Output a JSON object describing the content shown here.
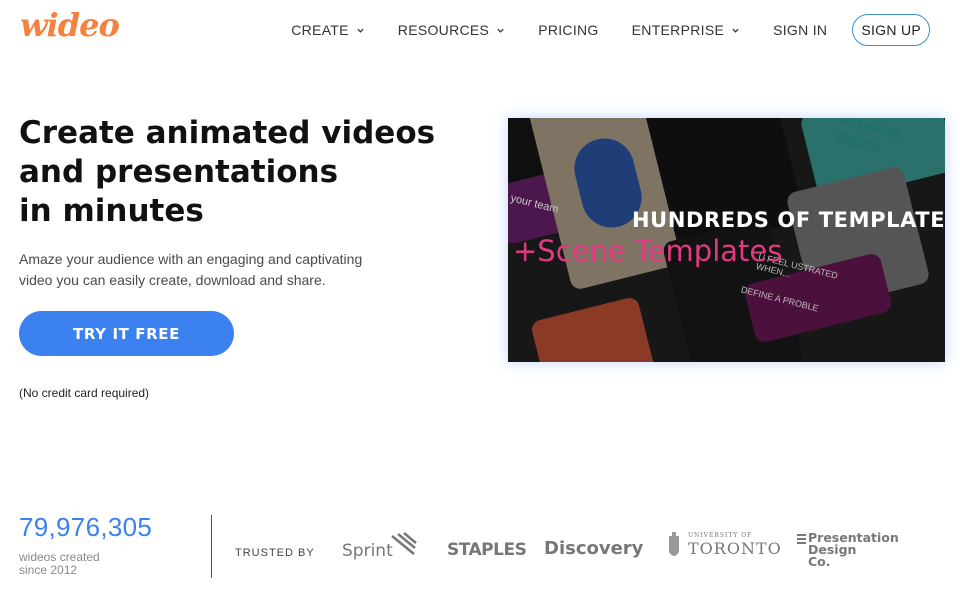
{
  "header": {
    "logo": "wideo",
    "nav": [
      {
        "label": "CREATE",
        "dropdown": true
      },
      {
        "label": "RESOURCES",
        "dropdown": true
      },
      {
        "label": "PRICING",
        "dropdown": false
      },
      {
        "label": "ENTERPRISE",
        "dropdown": true
      },
      {
        "label": "SIGN IN",
        "dropdown": false
      }
    ],
    "signup_label": "SIGN UP"
  },
  "hero": {
    "title_lines": [
      "Create animated videos",
      "and presentations",
      "in minutes"
    ],
    "subtitle_lines": [
      "Amaze your audience with an engaging and captivating",
      "video you can easily create, download and share."
    ],
    "cta_label": "TRY IT FREE",
    "note": "(No credit card required)"
  },
  "video": {
    "headline": "HUNDREDS OF TEMPLATES",
    "subheadline": "+Scene Templates",
    "tile_texts": [
      "Product Name",
      "your team",
      "U FEEL USTRATED WHEN...",
      "DEFINE A PROBLE"
    ]
  },
  "stats": {
    "count": "79,976,305",
    "label_lines": [
      "wideos created",
      "since 2012"
    ]
  },
  "trusted": {
    "label": "TRUSTED BY",
    "brands": [
      "Sprint",
      "STAPLES",
      "Discovery",
      "UNIVERSITY OF",
      "TORONTO",
      "Presentation",
      "Design",
      "Co."
    ]
  },
  "colors": {
    "brand_orange": "#f5813f",
    "accent_blue": "#3b82f0",
    "signup_border": "#3d8fd1",
    "template_pink": "#e23a82"
  }
}
